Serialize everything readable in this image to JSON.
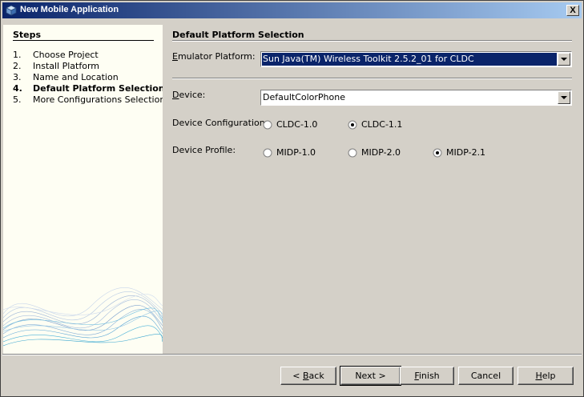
{
  "window": {
    "title": "New Mobile Application",
    "close_glyph": "X"
  },
  "steps": {
    "title": "Steps",
    "items": [
      {
        "num": "1.",
        "label": "Choose Project"
      },
      {
        "num": "2.",
        "label": "Install Platform"
      },
      {
        "num": "3.",
        "label": "Name and Location"
      },
      {
        "num": "4.",
        "label": "Default Platform Selection"
      },
      {
        "num": "5.",
        "label": "More Configurations Selection"
      }
    ],
    "current_index": 3
  },
  "content": {
    "title": "Default Platform Selection",
    "emulator": {
      "label_mnemonic": "E",
      "label_rest": "mulator Platform:",
      "value": "Sun Java(TM) Wireless Toolkit 2.5.2_01 for CLDC"
    },
    "device": {
      "label_mnemonic": "D",
      "label_rest": "evice:",
      "value": "DefaultColorPhone"
    },
    "configuration": {
      "label": "Device Configuration:",
      "options": [
        {
          "label": "CLDC-1.0",
          "checked": false
        },
        {
          "label": "CLDC-1.1",
          "checked": true
        }
      ]
    },
    "profile": {
      "label": "Device Profile:",
      "options": [
        {
          "label": "MIDP-1.0",
          "checked": false
        },
        {
          "label": "MIDP-2.0",
          "checked": false
        },
        {
          "label": "MIDP-2.1",
          "checked": true
        }
      ]
    }
  },
  "buttons": {
    "back_prefix": "< ",
    "back_mnemonic": "B",
    "back_rest": "ack",
    "next": "Next >",
    "finish_mnemonic": "F",
    "finish_rest": "inish",
    "cancel": "Cancel",
    "help_mnemonic": "H",
    "help_rest": "elp"
  },
  "colors": {
    "title_bar": "#0a246a",
    "selection": "#0a246a",
    "steps_bg": "#fefef3",
    "dialog_bg": "#d4d0c8"
  }
}
